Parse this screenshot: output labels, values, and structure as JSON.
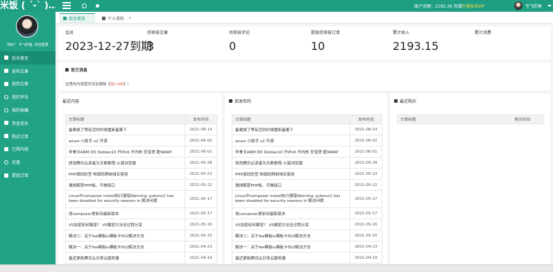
{
  "header": {
    "logo": "米饭 ( ´-` )…",
    "account_balance": "账户余额：2195.36 充值",
    "vip_link": "开通本站VIP",
    "user_name": "今飞的鱼"
  },
  "sidebar": {
    "greeting": "你好！ 今飞的鱼, 欢迎登录",
    "items": [
      {
        "label": "后台首页",
        "icon": "home-icon"
      },
      {
        "label": "发布文章",
        "icon": "edit-icon"
      },
      {
        "label": "我的文章",
        "icon": "document-icon"
      },
      {
        "label": "我的评论",
        "icon": "comment-icon"
      },
      {
        "label": "我的收藏",
        "icon": "star-icon"
      },
      {
        "label": "资金流水",
        "icon": "money-icon"
      },
      {
        "label": "购买订单",
        "icon": "cart-icon"
      },
      {
        "label": "已购内容",
        "icon": "bag-icon"
      },
      {
        "label": "充值",
        "icon": "recharge-icon"
      },
      {
        "label": "提现订单",
        "icon": "withdraw-icon"
      }
    ]
  },
  "tabs": [
    {
      "label": "后台首页",
      "active": true
    },
    {
      "label": "个人资料",
      "active": false
    }
  ],
  "stats": [
    {
      "label": "会员",
      "value": "2023-12-27到期"
    },
    {
      "label": "待审核文章",
      "value": "3"
    },
    {
      "label": "待审核评论",
      "value": "0"
    },
    {
      "label": "提现待审核订单",
      "value": "10"
    },
    {
      "label": "累计收入",
      "value": "2193.15"
    },
    {
      "label": "累计消费",
      "value": ""
    }
  ],
  "notice": {
    "title": "官方消息",
    "text_before": "这里的内容暂时没有编辑【",
    "vip": "加入VIP",
    "text_after": "】！"
  },
  "panels": {
    "recent": {
      "title": "最近内容",
      "col_title": "文章标题",
      "col_time": "发布时间",
      "rows": [
        {
          "title": "备案掉了等有空的时候重新备案下",
          "time": "2021-08-14"
        },
        {
          "title": "azure 小助手 v2 开源",
          "time": "2021-06-02"
        },
        {
          "title": "甲骨文ARM DD Debian10 开IPv6 开内核 安宝塔 配WARP",
          "time": "2021-06-01"
        },
        {
          "title": "修改腾讯云读者为天数数程-火狐浏览器",
          "time": "2021-05-28"
        },
        {
          "title": "PHP源码防签 物源码限制域名使用",
          "time": "2021-05-23"
        },
        {
          "title": "撤掉解密PHP板、可做接口",
          "time": "2021-05-22"
        },
        {
          "title": "Linux中composer install执行报错Warning: putenv() has been disabled for security reasons in 解决问题",
          "time": "2021-05-17"
        },
        {
          "title": "将composer更新到最新版本",
          "time": "2021-05-17"
        },
        {
          "title": "V5加密如何解密？ V5解密方法全过程分享",
          "time": "2021-05-16"
        },
        {
          "title": "解决二：关于fee模板lu模板卡502解决方法",
          "time": "2021-05-15"
        },
        {
          "title": "解决一：关于fee模板lu模板卡502解决方法",
          "time": "2021-04-23"
        },
        {
          "title": "最近更新腾讯云日常云服务器",
          "time": "2021-04-19"
        }
      ]
    },
    "mine": {
      "title": "我发布的",
      "col_title": "文章标题",
      "col_time": "发布时间",
      "rows": [
        {
          "title": "备案掉了等有空的时候重新备案下",
          "time": "2021-08-14"
        },
        {
          "title": "azure 小助手 v2 开源",
          "time": "2021-06-02"
        },
        {
          "title": "甲骨文ARM DD Debian10 开IPv6 开内核 安宝塔 配WARP",
          "time": "2021-06-01"
        },
        {
          "title": "修改腾讯云读者为天数数程-火狐浏览器",
          "time": "2021-05-28"
        },
        {
          "title": "PHP源码防签 物源码限制域名使用",
          "time": "2021-05-23"
        },
        {
          "title": "撤掉解密PHP板、可做接口",
          "time": "2021-05-22"
        },
        {
          "title": "Linux中composer install执行报错Warning: putenv() has been disabled for security reasons in 解决问题",
          "time": "2021-05-17"
        },
        {
          "title": "将composer更新到最新版本",
          "time": "2021-05-17"
        },
        {
          "title": "V5加密如何解密？ V5解密方法全过程分享",
          "time": "2021-05-16"
        },
        {
          "title": "解决二：关于fee模板lu模板卡502解决方法",
          "time": "2021-05-15"
        },
        {
          "title": "解决一：关于fee模板lu模板卡502解决方法",
          "time": "2021-04-23"
        },
        {
          "title": "最近更新腾讯云日常云服务器",
          "time": "2021-04-19"
        }
      ]
    },
    "purchases": {
      "title": "最近购买",
      "col_title": "文章标题",
      "col_time": "购买时间"
    }
  },
  "colors": {
    "brand": "#1e9f84",
    "sidebar": "#22a386",
    "vip_link": "#ffd84d",
    "notice_vip": "#e24c3f"
  }
}
